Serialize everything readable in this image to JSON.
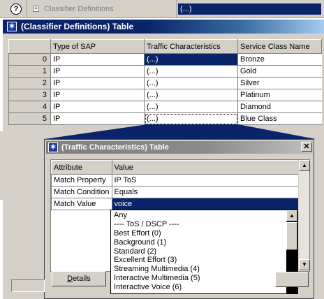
{
  "outer_attribute": {
    "label": "Classifier Definitions",
    "value": "(...)",
    "help_glyph": "?",
    "expand_glyph": "+"
  },
  "main_window": {
    "title": "(Classifier Definitions) Table",
    "columns": [
      "Type of SAP",
      "Traffic Characteristics",
      "Service Class Name"
    ],
    "rows": [
      {
        "index": "0",
        "type": "IP",
        "traffic": "(...)",
        "name": "Bronze"
      },
      {
        "index": "1",
        "type": "IP",
        "traffic": "(...)",
        "name": "Gold"
      },
      {
        "index": "2",
        "type": "IP",
        "traffic": "(...)",
        "name": "Silver"
      },
      {
        "index": "3",
        "type": "IP",
        "traffic": "(...)",
        "name": "Platinum"
      },
      {
        "index": "4",
        "type": "IP",
        "traffic": "(...)",
        "name": "Diamond"
      },
      {
        "index": "5",
        "type": "IP",
        "traffic": "(...)",
        "name": "Blue Class"
      }
    ],
    "accent": "#0a246a"
  },
  "popup": {
    "title": "(Traffic Characteristics) Table",
    "close_glyph": "✕",
    "columns": [
      "Attribute",
      "Value"
    ],
    "rows": [
      {
        "attribute": "Match Property",
        "value": "IP ToS"
      },
      {
        "attribute": "Match Condition",
        "value": "Equals"
      },
      {
        "attribute": "Match Value",
        "value": "voice"
      }
    ],
    "dropdown_options": [
      "Any",
      "---- ToS / DSCP ----",
      "Best Effort (0)",
      "Background (1)",
      "Standard (2)",
      "Excellent Effort (3)",
      "Streaming Multimedia (4)",
      "Interactive Multimedia (5)",
      "Interactive Voice (6)"
    ],
    "details_label_underlined": "D",
    "details_label_rest": "etails",
    "scroll_up_glyph": "▲",
    "scroll_down_glyph": "▼"
  },
  "icons": {
    "window": "star-icon",
    "help": "help-icon",
    "expand": "plus-box-icon",
    "close": "close-icon"
  }
}
